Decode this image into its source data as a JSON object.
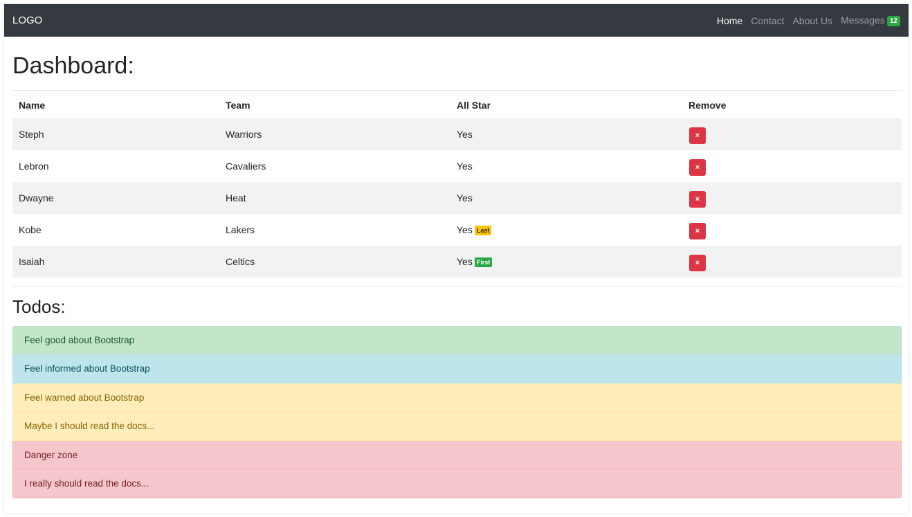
{
  "navbar": {
    "brand": "LOGO",
    "links": [
      {
        "label": "Home"
      },
      {
        "label": "Contact"
      },
      {
        "label": "About Us"
      },
      {
        "label": "Messages",
        "badge": "12"
      }
    ]
  },
  "dashboard": {
    "title": "Dashboard:",
    "columns": [
      "Name",
      "Team",
      "All Star",
      "Remove"
    ],
    "rows": [
      {
        "name": "Steph",
        "team": "Warriors",
        "all_star": "Yes",
        "badge": ""
      },
      {
        "name": "Lebron",
        "team": "Cavaliers",
        "all_star": "Yes",
        "badge": ""
      },
      {
        "name": "Dwayne",
        "team": "Heat",
        "all_star": "Yes",
        "badge": ""
      },
      {
        "name": "Kobe",
        "team": "Lakers",
        "all_star": "Yes",
        "badge": "Last"
      },
      {
        "name": "Isaiah",
        "team": "Celtics",
        "all_star": "Yes",
        "badge": "First"
      }
    ],
    "remove_glyph": "×"
  },
  "todos": {
    "title": "Todos:",
    "items": [
      {
        "text": "Feel good about Bootstrap"
      },
      {
        "text": "Feel informed about Bootstrap"
      },
      {
        "text": "Feel warned about Bootstrap"
      },
      {
        "text": "Maybe I should read the docs..."
      },
      {
        "text": "Danger zone"
      },
      {
        "text": "I really should read the docs..."
      }
    ]
  },
  "colors": {
    "navbar": "#343a40",
    "danger": "#dc3545",
    "warning_badge": "#ffc107",
    "success_badge": "#28a745"
  }
}
